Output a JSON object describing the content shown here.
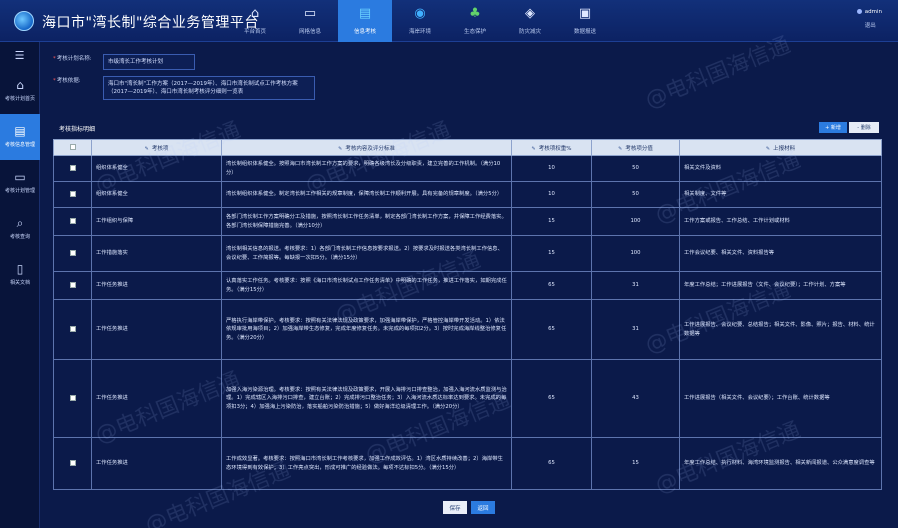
{
  "header": {
    "title": "海口市\"湾长制\"综合业务管理平台",
    "nav": [
      {
        "label": "平台首页",
        "icon": "home-icon",
        "glyph": "⌂"
      },
      {
        "label": "网格信息",
        "icon": "monitor-icon",
        "glyph": "▭"
      },
      {
        "label": "信息考核",
        "icon": "document-icon",
        "glyph": "▤"
      },
      {
        "label": "海岸环境",
        "icon": "earth-icon",
        "glyph": "◉"
      },
      {
        "label": "生态保护",
        "icon": "tree-icon",
        "glyph": "♣"
      },
      {
        "label": "防灾减灾",
        "icon": "diamond-icon",
        "glyph": "◈"
      },
      {
        "label": "数据报送",
        "icon": "screen-icon",
        "glyph": "▣"
      }
    ],
    "user": "admin",
    "logout": "退出"
  },
  "sidebar": {
    "items": [
      {
        "label": "考核计划首页",
        "glyph": "⌂",
        "icon": "home-icon"
      },
      {
        "label": "考核信息管理",
        "glyph": "▤",
        "icon": "clipboard-icon"
      },
      {
        "label": "考核计划管理",
        "glyph": "▭",
        "icon": "monitor-icon"
      },
      {
        "label": "考核查询",
        "glyph": "⌕",
        "icon": "search-doc-icon"
      },
      {
        "label": "相关文档",
        "glyph": "▯",
        "icon": "folder-icon"
      }
    ]
  },
  "form": {
    "name_label": "考核计划名称:",
    "name_value": "市级湾长工作考核计划",
    "basis_label": "考核依据:",
    "basis_value": "海口市\"湾长制\"工作方案（2017—2019年）、海口市湾长制试点工作考核方案（2017—2019年）、海口市湾长制考核评分细则一览表"
  },
  "section_title": "考核指标明细",
  "toolbar": {
    "add": "+ 新增",
    "delete": "- 删除"
  },
  "table": {
    "headers": [
      "",
      "考核项",
      "考核内容及评分标准",
      "考核项权重%",
      "考核项分值",
      "上报材料"
    ],
    "rows": [
      {
        "item": "组织体系健全",
        "content": "湾长制组织体系健全。按照海口市湾长制工作方案的要求，明确各级湾长及分级职责，建立完善的工作机制。（满分10分）",
        "weight": "10",
        "score": "50",
        "material": "相关文件及资料"
      },
      {
        "item": "组织体系健全",
        "content": "湾长制组织体系健全。制定湾长制工作相关的规章制度，保障湾长制工作顺利开展。具有完备的规章制度。（满分5分）",
        "weight": "10",
        "score": "50",
        "material": "相关制度、文件等"
      },
      {
        "item": "工作组织与保障",
        "content": "各部门湾长制工作方案明确分工及措施，按照湾长制工作任务清单，制定各部门湾长制工作方案，并保障工作经费落实。各部门湾长制保障措施完善。（满分10分）",
        "weight": "15",
        "score": "100",
        "material": "工作方案或报告、工作总结、工作计划或材料"
      },
      {
        "item": "工作措施落实",
        "content": "湾长制相关信息的报送。考核要求：1）各部门湾长制工作信息按要求报送。2）按要求及时报送各类湾长制工作信息、会议纪要、工作简报等。每缺报一次扣5分。（满分15分）",
        "weight": "15",
        "score": "100",
        "material": "工作会议纪要、相关文件、资料报告等"
      },
      {
        "item": "工作任务推进",
        "content": "认真落实工作任务。考核要求：按照《海口市湾长制试点工作任务清单》中明确的工作任务，推进工作落实，如期完成任务。（满分15分）",
        "weight": "65",
        "score": "31",
        "material": "年度工作总结；工作进展报告（文件、会议纪要）；工作计划、方案等"
      },
      {
        "item": "工作任务推进",
        "content": "严格执行海岸带保护。考核要求：按照有关法律法规及政策要求，加强海岸带保护，严格管控海岸带开发活动。1）依法依规审批用海项目；2）加强海岸带生态修复，完成年度修复任务。未完成的每项扣2分。3）按时完成海岸线整治修复任务。（满分20分）",
        "weight": "65",
        "score": "31",
        "material": "工作进展报告、会议纪要、总结报告；相关文件、影像、照片；报告、材料、统计数据等"
      },
      {
        "item": "工作任务推进",
        "content": "加强入海污染源治理。考核要求：按照有关法律法规及政策要求，开展入海排污口排查整治，加强入海河流水质监测与治理。1）完成辖区入海排污口排查，建立台账；2）完成排污口整治任务；3）入海河流水质达标率达到要求。未完成的每项扣3分；4）加强海上污染防治，落实船舶污染防治措施；5）做好海洋垃圾清理工作。（满分20分）",
        "weight": "65",
        "score": "43",
        "material": "工作进展报告（相关文件、会议纪要）；工作台账、统计数据等"
      },
      {
        "item": "工作任务推进",
        "content": "工作成效显著。考核要求：按照海口市湾长制工作考核要求，加强工作成效评估。1）湾区水质持续改善；2）海岸带生态环境得到有效保护；3）工作亮点突出，形成可推广的经验做法。每项不达标扣5分。（满分15分）",
        "weight": "65",
        "score": "15",
        "material": "年度工作总结、执行材料、海湾环境监测报告、相关新闻报道、公众满意度调查等"
      }
    ]
  },
  "buttons": {
    "save": "保存",
    "back": "返回"
  },
  "watermark": "@电科国海信通",
  "colors": {
    "accent": "#2b7be0",
    "background": "#0b1a4a",
    "header_row": "#d9e3f2"
  }
}
